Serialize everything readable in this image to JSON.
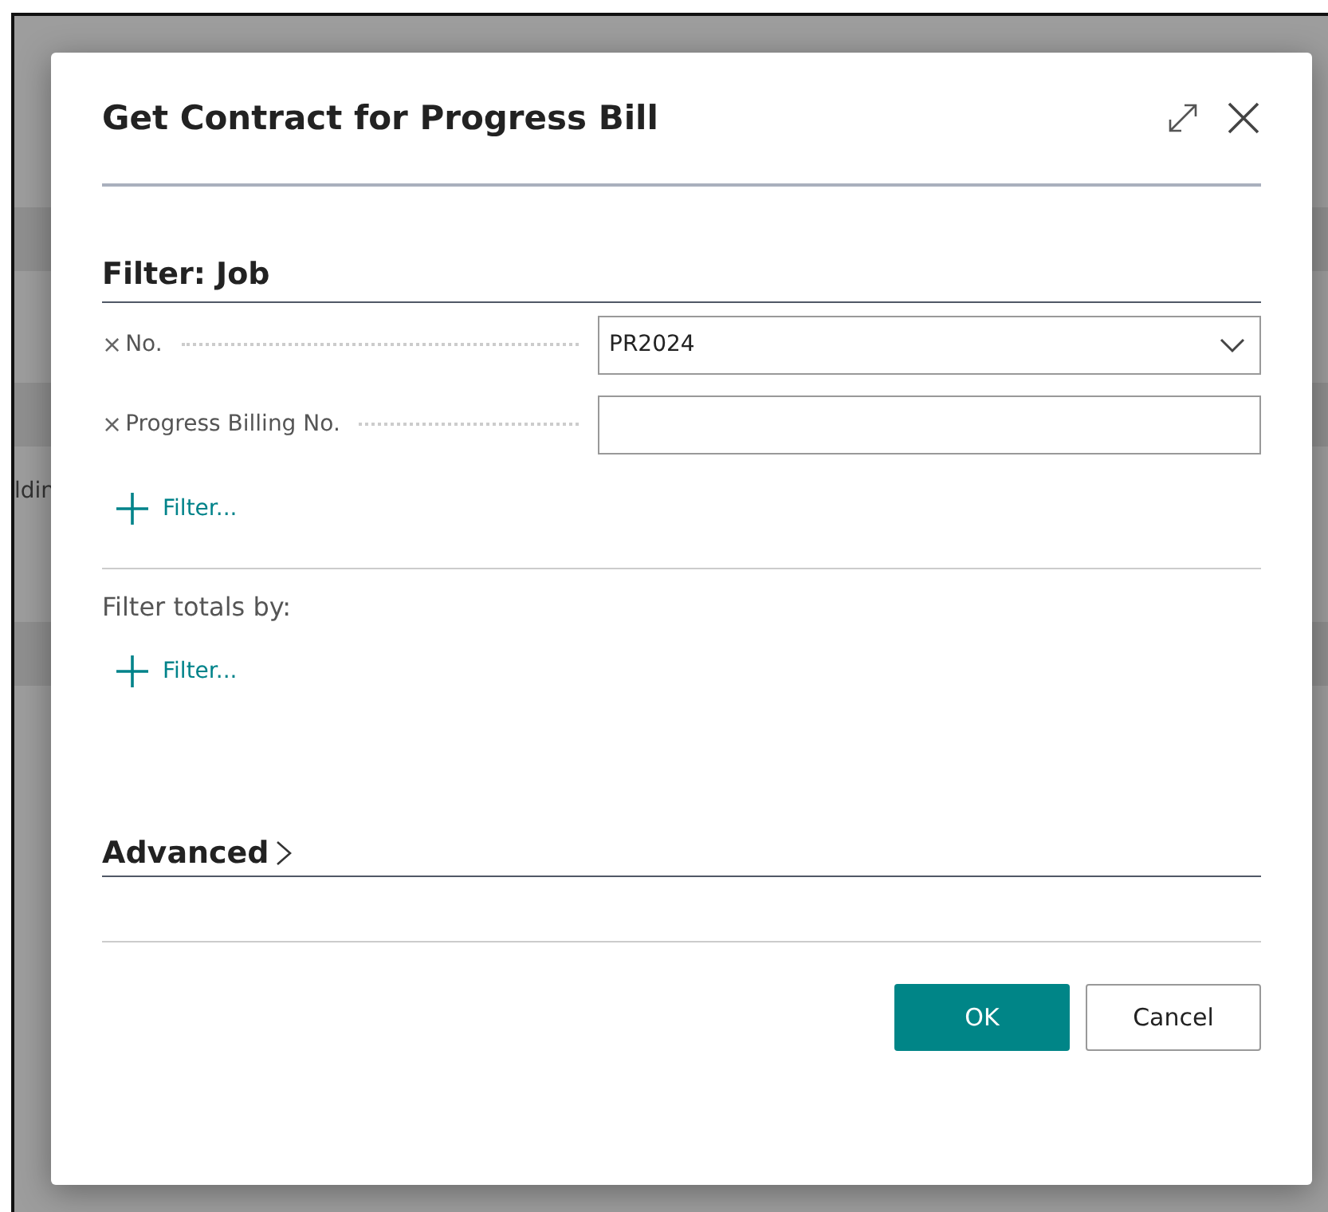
{
  "background": {
    "partial_text": "ldin"
  },
  "dialog": {
    "title": "Get Contract for Progress Bill",
    "section": {
      "title": "Filter: Job",
      "filters": [
        {
          "remove": "×",
          "label": "No.",
          "kind": "dropdown",
          "value": "PR2024"
        },
        {
          "remove": "×",
          "label": "Progress Billing No.",
          "kind": "text"
        }
      ],
      "add_filter": "Filter..."
    },
    "totals": {
      "title": "Filter totals by:",
      "add_filter": "Filter..."
    },
    "advanced": {
      "title": "Advanced",
      "expanded": false
    },
    "buttons": [
      {
        "label": "OK",
        "kind": "primary"
      },
      {
        "label": "Cancel",
        "kind": "secondary"
      }
    ]
  }
}
